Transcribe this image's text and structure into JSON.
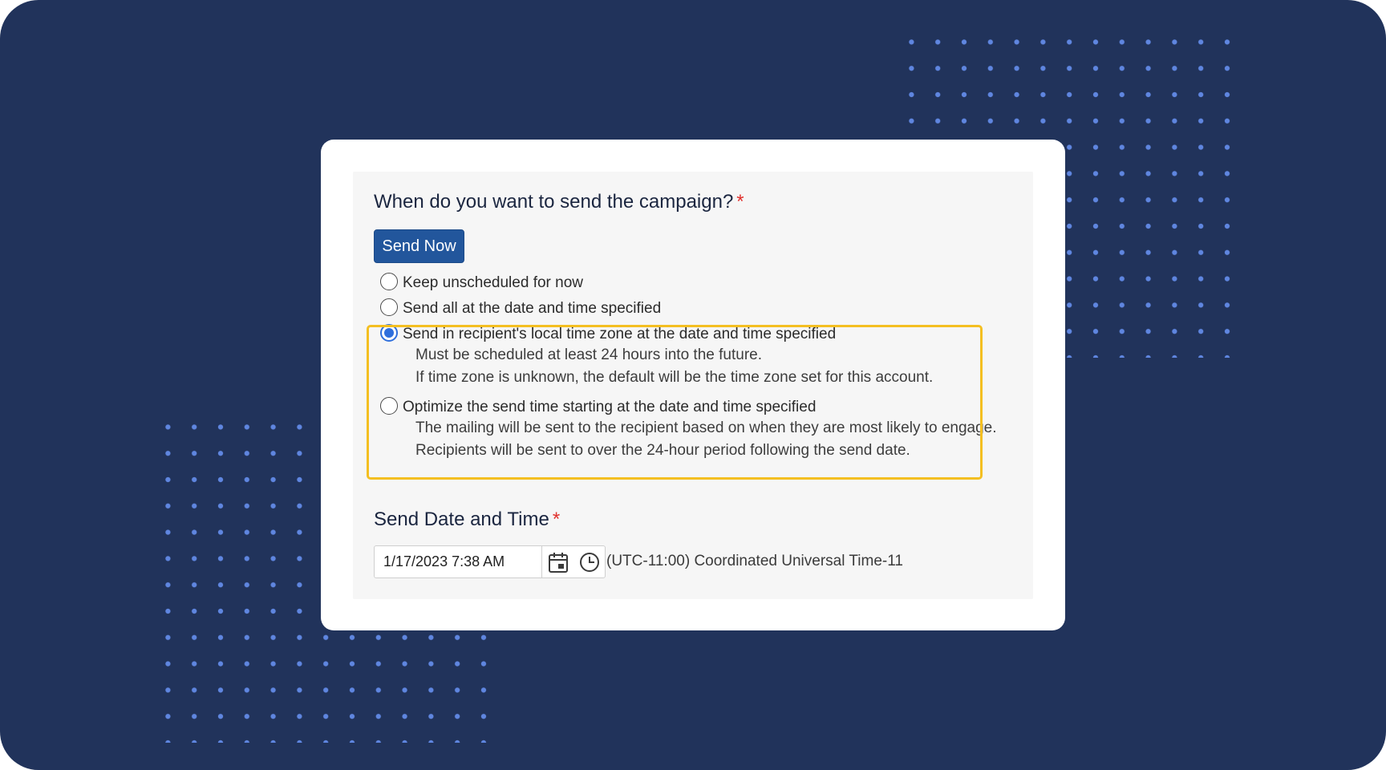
{
  "form": {
    "question": "When do you want to send the campaign?",
    "required_marker": "*",
    "send_now_label": "Send Now",
    "options": [
      {
        "label": "Keep unscheduled for now",
        "selected": false,
        "description": []
      },
      {
        "label": "Send all at the date and time specified",
        "selected": false,
        "description": []
      },
      {
        "label": "Send in recipient's local time zone at the date and time specified",
        "selected": true,
        "description": [
          "Must be scheduled at least 24 hours into the future.",
          "If time zone is unknown, the default will be the time zone set for this account."
        ]
      },
      {
        "label": "Optimize the send time starting at the date and time specified",
        "selected": false,
        "description": [
          "The mailing will be sent to the recipient based on when they are most likely to engage.",
          "Recipients will be sent to over the 24-hour period following the send date."
        ]
      }
    ],
    "send_date": {
      "heading": "Send Date and Time",
      "value": "1/17/2023 7:38 AM",
      "calendar_icon": "calendar-icon",
      "clock_icon": "clock-icon",
      "timezone": "(UTC-11:00) Coordinated Universal Time-11"
    }
  },
  "colors": {
    "background": "#21335b",
    "dots": "#5f86e0",
    "button": "#22569c",
    "highlight": "#f4bf21",
    "required": "#e0302c",
    "radio_selected": "#2f6fdc"
  }
}
